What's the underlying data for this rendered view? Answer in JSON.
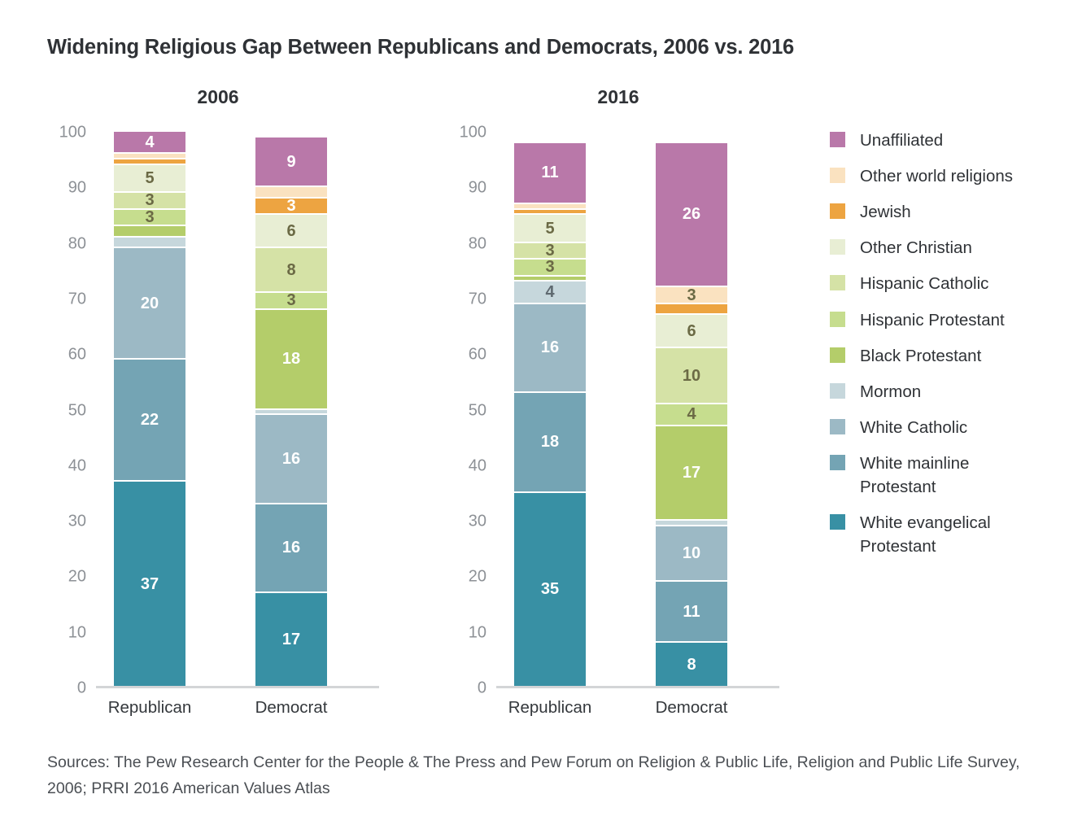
{
  "title": "Widening Religious Gap Between Republicans and Democrats, 2006 vs. 2016",
  "source": "Sources: The Pew Research Center for the People & The Press and Pew Forum on Religion & Public Life, Religion and Public Life Survey, 2006; PRRI 2016 American Values Atlas",
  "panels": [
    {
      "title": "2006",
      "groups": [
        "Republican",
        "Democrat"
      ]
    },
    {
      "title": "2016",
      "groups": [
        "Republican",
        "Democrat"
      ]
    }
  ],
  "legend": [
    {
      "label": "Unaffiliated",
      "color": "#b978a9"
    },
    {
      "label": "Other world religions",
      "color": "#fae2c0"
    },
    {
      "label": "Jewish",
      "color": "#eda441"
    },
    {
      "label": "Other Christian",
      "color": "#e8eed4"
    },
    {
      "label": "Hispanic Catholic",
      "color": "#d5e2a6"
    },
    {
      "label": "Hispanic Protestant",
      "color": "#c6dd8e"
    },
    {
      "label": "Black Protestant",
      "color": "#b4cd6a"
    },
    {
      "label": "Mormon",
      "color": "#c6d7dc"
    },
    {
      "label": "White Catholic",
      "color": "#9cb9c5"
    },
    {
      "label": "White mainline Protestant",
      "color": "#74a4b4"
    },
    {
      "label": "White evangelical Protestant",
      "color": "#3890a4"
    }
  ],
  "chart_data": {
    "type": "bar",
    "subtype": "stacked-100",
    "title": "Widening Religious Gap Between Republicans and Democrats, 2006 vs. 2016",
    "xlabel": "",
    "ylabel": "",
    "ylim": [
      0,
      100
    ],
    "yticks": [
      0,
      10,
      20,
      30,
      40,
      50,
      60,
      70,
      80,
      90,
      100
    ],
    "grid": false,
    "legend_position": "right",
    "series_order_bottom_to_top": [
      "White evangelical Protestant",
      "White mainline Protestant",
      "White Catholic",
      "Mormon",
      "Black Protestant",
      "Hispanic Protestant",
      "Hispanic Catholic",
      "Other Christian",
      "Jewish",
      "Other world religions",
      "Unaffiliated"
    ],
    "panels": [
      {
        "title": "2006",
        "categories": [
          "Republican",
          "Democrat"
        ],
        "series": [
          {
            "name": "White evangelical Protestant",
            "values": [
              37,
              17
            ],
            "labels": [
              "37",
              "17"
            ]
          },
          {
            "name": "White mainline Protestant",
            "values": [
              22,
              16
            ],
            "labels": [
              "22",
              "16"
            ]
          },
          {
            "name": "White Catholic",
            "values": [
              20,
              16
            ],
            "labels": [
              "20",
              "16"
            ]
          },
          {
            "name": "Mormon",
            "values": [
              2,
              1
            ],
            "labels": [
              "",
              ""
            ]
          },
          {
            "name": "Black Protestant",
            "values": [
              2,
              18
            ],
            "labels": [
              "",
              "18"
            ]
          },
          {
            "name": "Hispanic Protestant",
            "values": [
              3,
              3
            ],
            "labels": [
              "3",
              "3"
            ]
          },
          {
            "name": "Hispanic Catholic",
            "values": [
              3,
              8
            ],
            "labels": [
              "3",
              "8"
            ]
          },
          {
            "name": "Other Christian",
            "values": [
              5,
              6
            ],
            "labels": [
              "5",
              "6"
            ]
          },
          {
            "name": "Jewish",
            "values": [
              1,
              3
            ],
            "labels": [
              "",
              "3"
            ]
          },
          {
            "name": "Other world religions",
            "values": [
              1,
              2
            ],
            "labels": [
              "",
              ""
            ]
          },
          {
            "name": "Unaffiliated",
            "values": [
              4,
              9
            ],
            "labels": [
              "4",
              "9"
            ]
          }
        ]
      },
      {
        "title": "2016",
        "categories": [
          "Republican",
          "Democrat"
        ],
        "series": [
          {
            "name": "White evangelical Protestant",
            "values": [
              35,
              8
            ],
            "labels": [
              "35",
              "8"
            ]
          },
          {
            "name": "White mainline Protestant",
            "values": [
              18,
              11
            ],
            "labels": [
              "18",
              "11"
            ]
          },
          {
            "name": "White Catholic",
            "values": [
              16,
              10
            ],
            "labels": [
              "16",
              "10"
            ]
          },
          {
            "name": "Mormon",
            "values": [
              4,
              1
            ],
            "labels": [
              "4",
              ""
            ]
          },
          {
            "name": "Black Protestant",
            "values": [
              1,
              17
            ],
            "labels": [
              "",
              "17"
            ]
          },
          {
            "name": "Hispanic Protestant",
            "values": [
              3,
              4
            ],
            "labels": [
              "3",
              "4"
            ]
          },
          {
            "name": "Hispanic Catholic",
            "values": [
              3,
              10
            ],
            "labels": [
              "3",
              "10"
            ]
          },
          {
            "name": "Other Christian",
            "values": [
              5,
              6
            ],
            "labels": [
              "5",
              "6"
            ]
          },
          {
            "name": "Jewish",
            "values": [
              1,
              2
            ],
            "labels": [
              "",
              ""
            ]
          },
          {
            "name": "Other world religions",
            "values": [
              1,
              3
            ],
            "labels": [
              "",
              "3"
            ]
          },
          {
            "name": "Unaffiliated",
            "values": [
              11,
              26
            ],
            "labels": [
              "11",
              "26"
            ]
          }
        ]
      }
    ]
  }
}
